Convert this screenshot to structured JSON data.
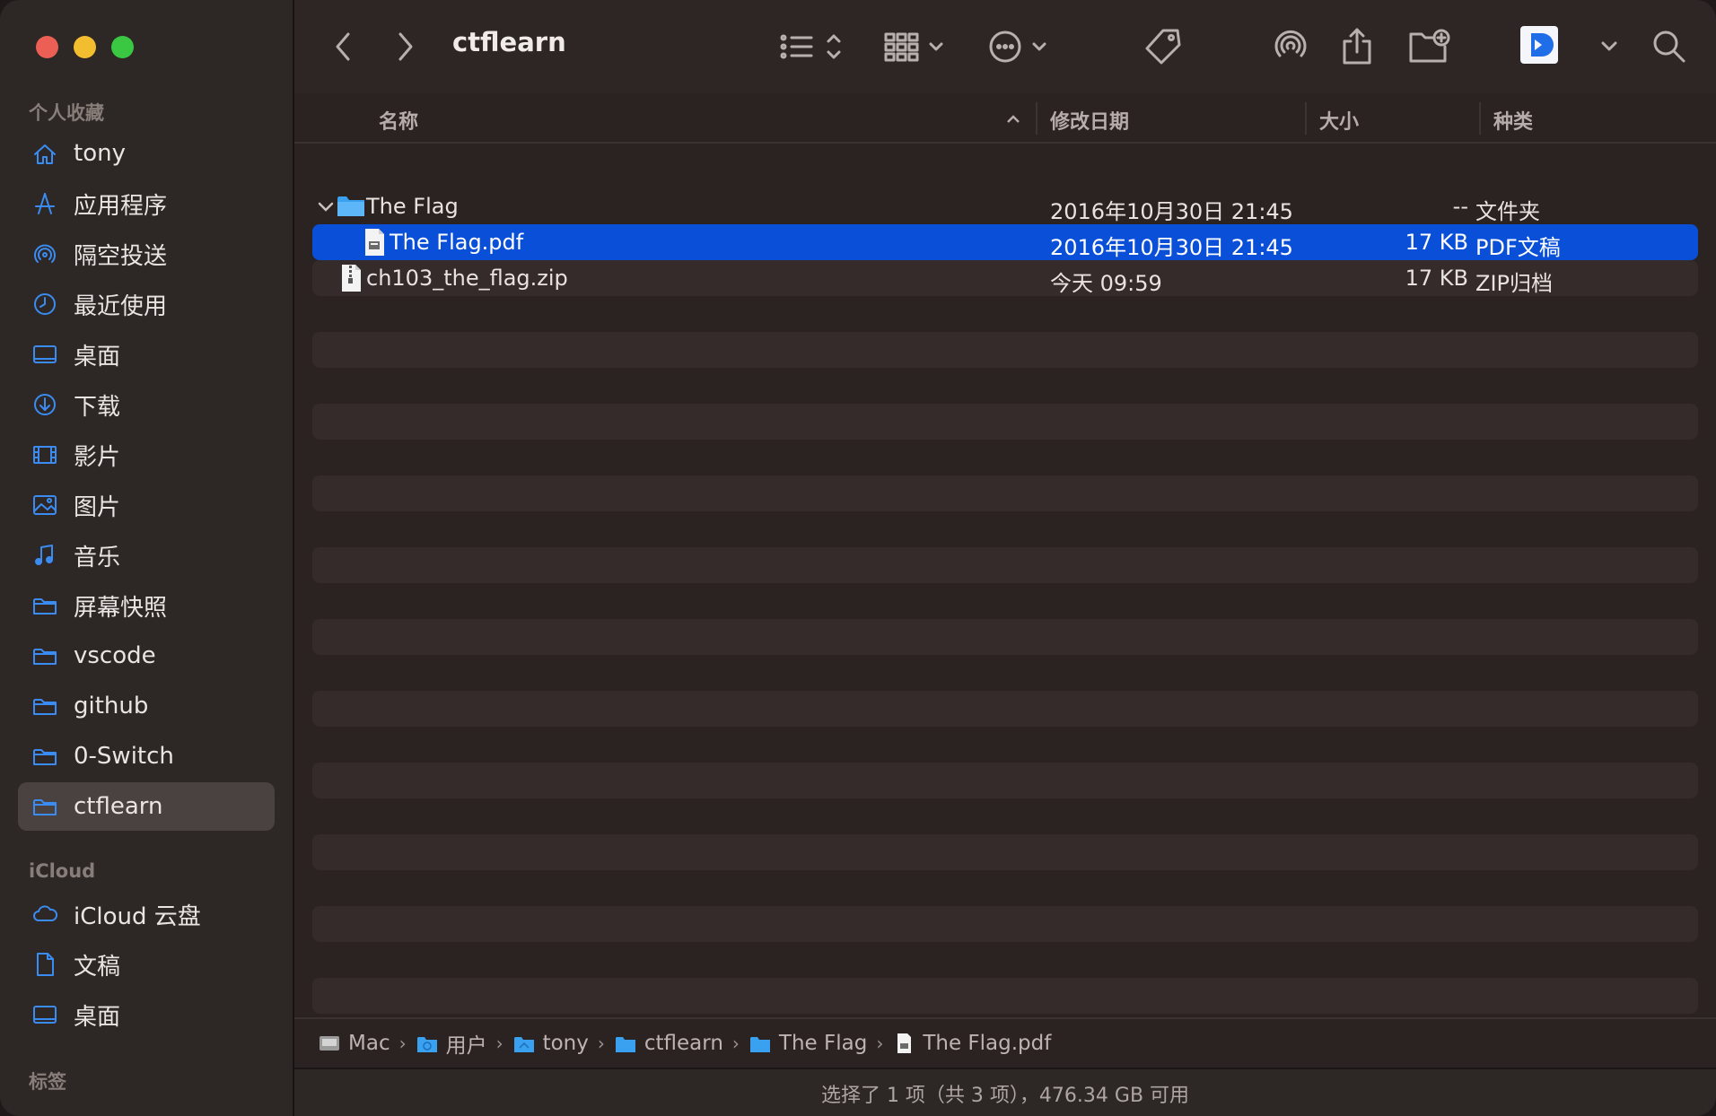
{
  "window": {
    "title": "ctflearn"
  },
  "sidebar": {
    "favorites_header": "个人收藏",
    "favorites": [
      {
        "label": "tony",
        "icon": "home-icon"
      },
      {
        "label": "应用程序",
        "icon": "applications-icon"
      },
      {
        "label": "隔空投送",
        "icon": "airdrop-icon"
      },
      {
        "label": "最近使用",
        "icon": "clock-icon"
      },
      {
        "label": "桌面",
        "icon": "desktop-icon"
      },
      {
        "label": "下载",
        "icon": "download-icon"
      },
      {
        "label": "影片",
        "icon": "film-icon"
      },
      {
        "label": "图片",
        "icon": "photo-icon"
      },
      {
        "label": "音乐",
        "icon": "music-icon"
      },
      {
        "label": "屏幕快照",
        "icon": "folder-icon"
      },
      {
        "label": "vscode",
        "icon": "folder-icon"
      },
      {
        "label": "github",
        "icon": "folder-icon"
      },
      {
        "label": "0-Switch",
        "icon": "folder-icon"
      },
      {
        "label": "ctflearn",
        "icon": "folder-icon",
        "active": true
      }
    ],
    "icloud_header": "iCloud",
    "icloud": [
      {
        "label": "iCloud 云盘",
        "icon": "cloud-icon"
      },
      {
        "label": "文稿",
        "icon": "document-icon"
      },
      {
        "label": "桌面",
        "icon": "desktop-icon"
      }
    ],
    "tags_header": "标签"
  },
  "columns": {
    "name": "名称",
    "date": "修改日期",
    "size": "大小",
    "kind": "种类"
  },
  "files": [
    {
      "name": "The Flag",
      "date": "2016年10月30日 21:45",
      "size": "--",
      "kind": "文件夹",
      "type": "folder",
      "expanded": true,
      "indent": 0
    },
    {
      "name": "The Flag.pdf",
      "date": "2016年10月30日 21:45",
      "size": "17 KB",
      "kind": "PDF文稿",
      "type": "pdf",
      "selected": true,
      "indent": 1
    },
    {
      "name": "ch103_the_flag.zip",
      "date": "今天 09:59",
      "size": "17 KB",
      "kind": "ZIP归档",
      "type": "zip",
      "indent": 0
    }
  ],
  "pathbar": [
    "Mac",
    "用户",
    "tony",
    "ctflearn",
    "The Flag",
    "The Flag.pdf"
  ],
  "status": "选择了 1 项（共 3 项），476.34 GB 可用",
  "colors": {
    "accent": "#0a4fd8",
    "folder": "#3aa0f0",
    "sidebar_icon": "#3b8cf2"
  }
}
